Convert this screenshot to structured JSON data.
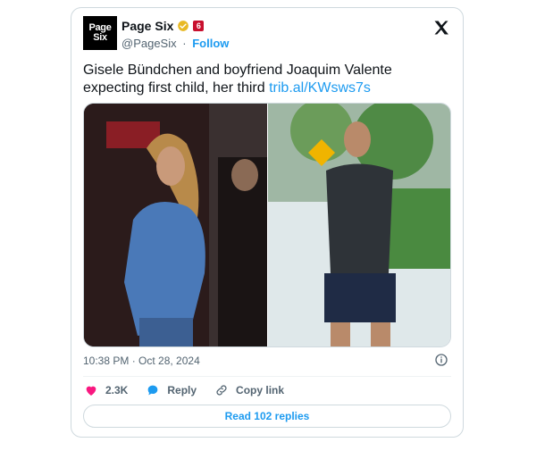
{
  "account": {
    "avatar_line1": "Page",
    "avatar_line2": "Six",
    "name": "Page Six",
    "handle": "@PageSix",
    "separator": "·",
    "follow_label": "Follow",
    "verified_color": "#e8b923",
    "affiliate_color": "#c8102e"
  },
  "tweet": {
    "text": "Gisele Bündchen and boyfriend Joaquim Valente expecting first child, her third ",
    "link": "trib.al/KWsws7s",
    "link_color": "#1d9bf0"
  },
  "meta": {
    "timestamp": "10:38 PM · Oct 28, 2024"
  },
  "actions": {
    "likes": "2.3K",
    "reply_label": "Reply",
    "copy_label": "Copy link"
  },
  "replies_button": "Read 102 replies",
  "icons": [
    "x-logo-icon",
    "verified-icon",
    "info-icon",
    "heart-icon",
    "reply-icon",
    "link-icon"
  ]
}
